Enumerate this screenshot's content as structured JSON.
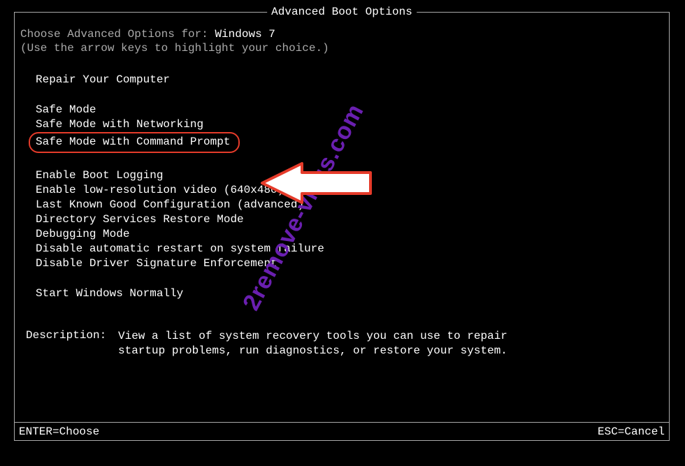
{
  "title": "Advanced Boot Options",
  "prompt": {
    "label": "Choose Advanced Options for: ",
    "os": "Windows 7"
  },
  "hint": "(Use the arrow keys to highlight your choice.)",
  "menu": {
    "group1": [
      "Repair Your Computer"
    ],
    "group2": [
      "Safe Mode",
      "Safe Mode with Networking",
      "Safe Mode with Command Prompt"
    ],
    "group3": [
      "Enable Boot Logging",
      "Enable low-resolution video (640x480)",
      "Last Known Good Configuration (advanced)",
      "Directory Services Restore Mode",
      "Debugging Mode",
      "Disable automatic restart on system failure",
      "Disable Driver Signature Enforcement"
    ],
    "group4": [
      "Start Windows Normally"
    ]
  },
  "highlighted_index": 2,
  "description": {
    "label": "Description:",
    "text": "View a list of system recovery tools you can use to repair startup problems, run diagnostics, or restore your system."
  },
  "footer": {
    "left": "ENTER=Choose",
    "right": "ESC=Cancel"
  },
  "watermark": "2remove-virus.com"
}
